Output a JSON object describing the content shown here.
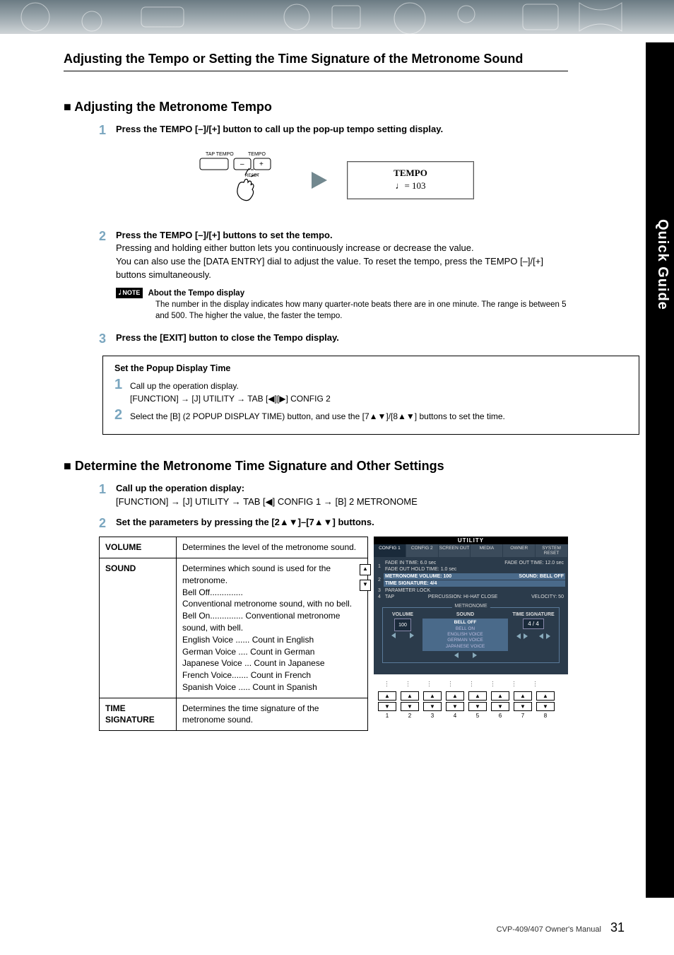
{
  "sidebar_tab": "Quick Guide",
  "h1": "Adjusting the Tempo or Setting the Time Signature of the Metronome Sound",
  "section_a": {
    "title": "■ Adjusting the Metronome Tempo",
    "step1_title": "Press the TEMPO [–]/[+] button to call up the pop-up tempo setting display.",
    "diagram": {
      "tap_tempo_label": "TAP TEMPO",
      "tempo_label": "TEMPO",
      "minus": "–",
      "plus": "+",
      "reset": "RESET",
      "screen_title": "TEMPO",
      "screen_value": "♩= 103"
    },
    "step2_title": "Press the TEMPO [–]/[+] buttons to set the tempo.",
    "step2_text1": "Pressing and holding either button lets you continuously increase or decrease the value.",
    "step2_text2": "You can also use the [DATA ENTRY] dial to adjust the value. To reset the tempo, press the TEMPO [–]/[+] buttons simultaneously.",
    "note_badge": "𝅘𝅥 NOTE",
    "note_title": "About the Tempo display",
    "note_body": "The number in the display indicates how many quarter-note beats there are in one minute. The range is between 5 and 500. The higher the value, the faster the tempo.",
    "step3_title": "Press the [EXIT] button to close the Tempo display."
  },
  "popup_box": {
    "title": "Set the Popup Display Time",
    "step1_text": "Call up the operation display.",
    "step1_path": "[FUNCTION] → [J] UTILITY → TAB [◀][▶] CONFIG 2",
    "step2_text": "Select the [B] (2 POPUP DISPLAY TIME) button, and use the [7▲▼]/[8▲▼] buttons to set the time."
  },
  "section_b": {
    "title": "■ Determine the Metronome Time Signature and Other Settings",
    "step1_title": "Call up the operation display:",
    "step1_path": "[FUNCTION] → [J] UTILITY → TAB [◀] CONFIG 1 → [B] 2 METRONOME",
    "step2_title": "Set the parameters by pressing the [2▲▼]–[7▲▼] buttons.",
    "table": [
      {
        "label": "VOLUME",
        "desc": "Determines the level of the metronome sound."
      },
      {
        "label": "SOUND",
        "desc_intro": "Determines which sound is used for the metronome.",
        "items": [
          [
            "Bell Off..............",
            "Conventional metronome sound, with no bell."
          ],
          [
            "Bell On..............",
            "Conventional metronome sound, with bell."
          ],
          [
            "English Voice ......",
            "Count in English"
          ],
          [
            "German Voice ....",
            "Count in German"
          ],
          [
            "Japanese Voice ...",
            "Count in Japanese"
          ],
          [
            "French Voice.......",
            "Count in French"
          ],
          [
            "Spanish Voice .....",
            "Count in Spanish"
          ]
        ]
      },
      {
        "label": "TIME SIGNATURE",
        "desc": "Determines the time signature of the metronome sound."
      }
    ]
  },
  "utility": {
    "title": "UTILITY",
    "tabs": [
      "CONFIG 1",
      "CONFIG 2",
      "SCREEN OUT",
      "MEDIA",
      "OWNER",
      "SYSTEM RESET"
    ],
    "active_tab": 0,
    "ab_up": "▲",
    "ab_down": "▼",
    "rows": {
      "r1a": "FADE IN TIME:  6.0 sec",
      "r1b": "FADE OUT TIME: 12.0 sec",
      "r1c": "FADE OUT HOLD TIME: 1.0 sec",
      "r2a": "METRONOME VOLUME: 100",
      "r2b": "SOUND: BELL OFF",
      "r2c": "TIME SIGNATURE:   4/4",
      "r3": "PARAMETER LOCK",
      "r4a": "TAP",
      "r4b": "PERCUSSION: HI-HAT CLOSE",
      "r4c": "VELOCITY: 50"
    },
    "group_title": "METRONOME",
    "cols": {
      "volume": {
        "title": "VOLUME",
        "value": "100"
      },
      "sound": {
        "title": "SOUND",
        "list": [
          "BELL OFF",
          "BELL ON",
          "ENGLISH VOICE",
          "GERMAN VOICE",
          "JAPANESE VOICE"
        ],
        "selected": 0
      },
      "ts": {
        "title": "TIME SIGNATURE",
        "value": "4 / 4"
      }
    },
    "button_nums": [
      "1",
      "2",
      "3",
      "4",
      "5",
      "6",
      "7",
      "8"
    ],
    "up": "▲",
    "down": "▼"
  },
  "footer": {
    "text": "CVP-409/407 Owner's Manual",
    "page": "31"
  }
}
